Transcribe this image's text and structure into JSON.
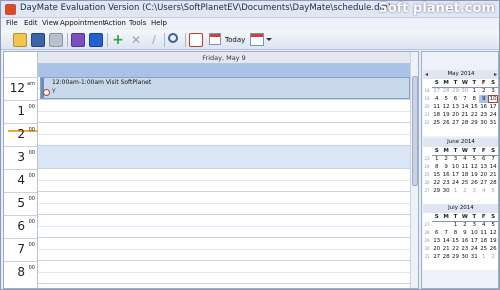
{
  "window": {
    "title": "DayMate Evaluation Version (C:\\Users\\SoftPlanetEV\\Documents\\DayMate\\schedule.dm)",
    "watermark": "Soft planet.com"
  },
  "menu": [
    "File",
    "Edit",
    "View",
    "Appointment",
    "Action",
    "Tools",
    "Help"
  ],
  "toolbar": {
    "today_label": "Today"
  },
  "dayview": {
    "header": "Friday, May 9",
    "hours": [
      {
        "num": "12",
        "ampm": "am"
      },
      {
        "num": "1",
        "ampm": "00"
      },
      {
        "num": "2",
        "ampm": "00"
      },
      {
        "num": "3",
        "ampm": "00"
      },
      {
        "num": "4",
        "ampm": "00"
      },
      {
        "num": "5",
        "ampm": "00"
      },
      {
        "num": "6",
        "ampm": "00"
      },
      {
        "num": "7",
        "ampm": "00"
      },
      {
        "num": "8",
        "ampm": "00"
      }
    ],
    "appointment": {
      "title": "12:00am-1:00am Visit SoftPlanet",
      "note": "Y"
    }
  },
  "calendars": [
    {
      "month": "May 2014",
      "dow": [
        "S",
        "M",
        "T",
        "W",
        "T",
        "F",
        "S"
      ],
      "weeks": [
        {
          "wk": "18",
          "days": [
            "27",
            "28",
            "29",
            "30",
            "1",
            "2",
            "3"
          ],
          "other": [
            1,
            1,
            1,
            1,
            0,
            0,
            0
          ]
        },
        {
          "wk": "19",
          "days": [
            "4",
            "5",
            "6",
            "7",
            "8",
            "9",
            "10"
          ],
          "other": [
            0,
            0,
            0,
            0,
            0,
            0,
            0
          ]
        },
        {
          "wk": "20",
          "days": [
            "11",
            "12",
            "13",
            "14",
            "15",
            "16",
            "17"
          ],
          "other": [
            0,
            0,
            0,
            0,
            0,
            0,
            0
          ]
        },
        {
          "wk": "21",
          "days": [
            "18",
            "19",
            "20",
            "21",
            "22",
            "23",
            "24"
          ],
          "other": [
            0,
            0,
            0,
            0,
            0,
            0,
            0
          ]
        },
        {
          "wk": "22",
          "days": [
            "25",
            "26",
            "27",
            "28",
            "29",
            "30",
            "31"
          ],
          "other": [
            0,
            0,
            0,
            0,
            0,
            0,
            0
          ]
        }
      ],
      "selected_day": "9",
      "today_day": "10"
    },
    {
      "month": "June 2014",
      "dow": [
        "S",
        "M",
        "T",
        "W",
        "T",
        "F",
        "S"
      ],
      "weeks": [
        {
          "wk": "23",
          "days": [
            "1",
            "2",
            "3",
            "4",
            "5",
            "6",
            "7"
          ],
          "other": [
            0,
            0,
            0,
            0,
            0,
            0,
            0
          ]
        },
        {
          "wk": "24",
          "days": [
            "8",
            "9",
            "10",
            "11",
            "12",
            "13",
            "14"
          ],
          "other": [
            0,
            0,
            0,
            0,
            0,
            0,
            0
          ]
        },
        {
          "wk": "25",
          "days": [
            "15",
            "16",
            "17",
            "18",
            "19",
            "20",
            "21"
          ],
          "other": [
            0,
            0,
            0,
            0,
            0,
            0,
            0
          ]
        },
        {
          "wk": "26",
          "days": [
            "22",
            "23",
            "24",
            "25",
            "26",
            "27",
            "28"
          ],
          "other": [
            0,
            0,
            0,
            0,
            0,
            0,
            0
          ]
        },
        {
          "wk": "27",
          "days": [
            "29",
            "30",
            "1",
            "2",
            "3",
            "4",
            "5"
          ],
          "other": [
            0,
            0,
            1,
            1,
            1,
            1,
            1
          ]
        }
      ]
    },
    {
      "month": "July 2014",
      "dow": [
        "S",
        "M",
        "T",
        "W",
        "T",
        "F",
        "S"
      ],
      "weeks": [
        {
          "wk": "27",
          "days": [
            "",
            "",
            "1",
            "2",
            "3",
            "4",
            "5"
          ],
          "other": [
            0,
            0,
            0,
            0,
            0,
            0,
            0
          ]
        },
        {
          "wk": "28",
          "days": [
            "6",
            "7",
            "8",
            "9",
            "10",
            "11",
            "12"
          ],
          "other": [
            0,
            0,
            0,
            0,
            0,
            0,
            0
          ]
        },
        {
          "wk": "29",
          "days": [
            "13",
            "14",
            "15",
            "16",
            "17",
            "18",
            "19"
          ],
          "other": [
            0,
            0,
            0,
            0,
            0,
            0,
            0
          ]
        },
        {
          "wk": "30",
          "days": [
            "20",
            "21",
            "22",
            "23",
            "24",
            "25",
            "26"
          ],
          "other": [
            0,
            0,
            0,
            0,
            0,
            0,
            0
          ]
        },
        {
          "wk": "31",
          "days": [
            "27",
            "28",
            "29",
            "30",
            "31",
            "1",
            "2"
          ],
          "other": [
            0,
            0,
            0,
            0,
            0,
            1,
            1
          ]
        }
      ]
    }
  ]
}
